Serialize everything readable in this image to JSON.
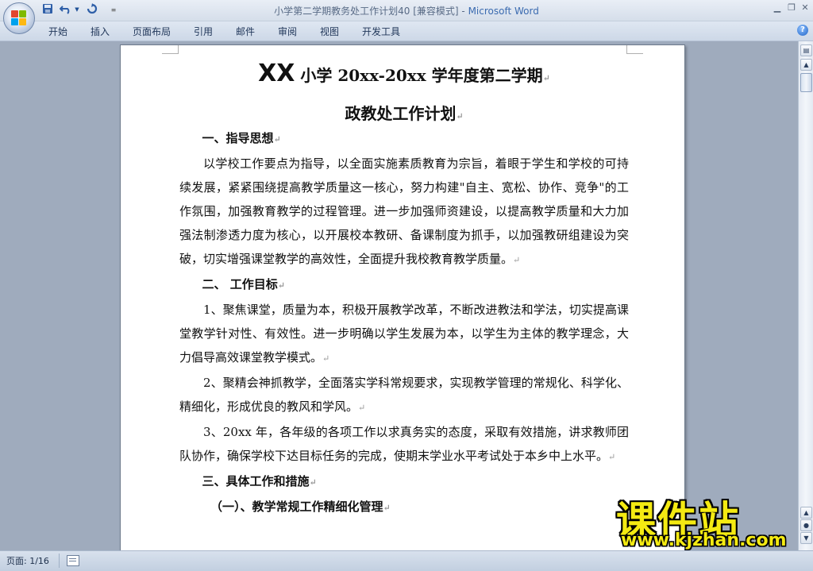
{
  "window": {
    "title_doc": "小学第二学期教务处工作计划40 [兼容模式] - ",
    "title_app": "Microsoft Word"
  },
  "quick_access": {
    "save_icon": "save-icon",
    "undo_icon": "undo-icon",
    "redo_icon": "redo-icon",
    "customize_icon": "dropdown-icon"
  },
  "ribbon": {
    "tabs": [
      "开始",
      "插入",
      "页面布局",
      "引用",
      "邮件",
      "审阅",
      "视图",
      "开发工具"
    ]
  },
  "document": {
    "title_xx": "XX",
    "title_rest": " 小学 20xx-20xx 学年度第二学期",
    "subtitle": "政教处工作计划",
    "section1_heading": "一、指导思想",
    "section1_body": "以学校工作要点为指导，以全面实施素质教育为宗旨，着眼于学生和学校的可持续发展，紧紧围绕提高教学质量这一核心，努力构建\"自主、宽松、协作、竞争\"的工作氛围，加强教育教学的过程管理。进一步加强师资建设，以提高教学质量和大力加强法制渗透力度为核心，以开展校本教研、备课制度为抓手，以加强教研组建设为突破，切实增强课堂教学的高效性，全面提升我校教育教学质量。",
    "section2_heading": "二、 工作目标",
    "goal1": "1、聚焦课堂，质量为本，积极开展教学改革，不断改进教法和学法，切实提高课堂教学针对性、有效性。进一步明确以学生发展为本，以学生为主体的教学理念，大力倡导高效课堂教学模式。",
    "goal2": "2、聚精会神抓教学，全面落实学科常规要求，实现教学管理的常规化、科学化、精细化，形成优良的教风和学风。",
    "goal3": " 3、20xx 年，各年级的各项工作以求真务实的态度，采取有效措施，讲求教师团队协作，确保学校下达目标任务的完成，使期末学业水平考试处于本乡中上水平。",
    "section3_heading": "三、具体工作和措施",
    "subsection1_heading": "（一）、教学常规工作精细化管理",
    "para_mark": "↵"
  },
  "statusbar": {
    "page_label": "页面: 1/16"
  },
  "watermark": {
    "main": "课件站",
    "url": "www.kjzhan.com"
  },
  "colors": {
    "watermark_yellow": "#f4ea12",
    "title_app_blue": "#3b6bb0",
    "doc_background": "#9fabbd"
  }
}
